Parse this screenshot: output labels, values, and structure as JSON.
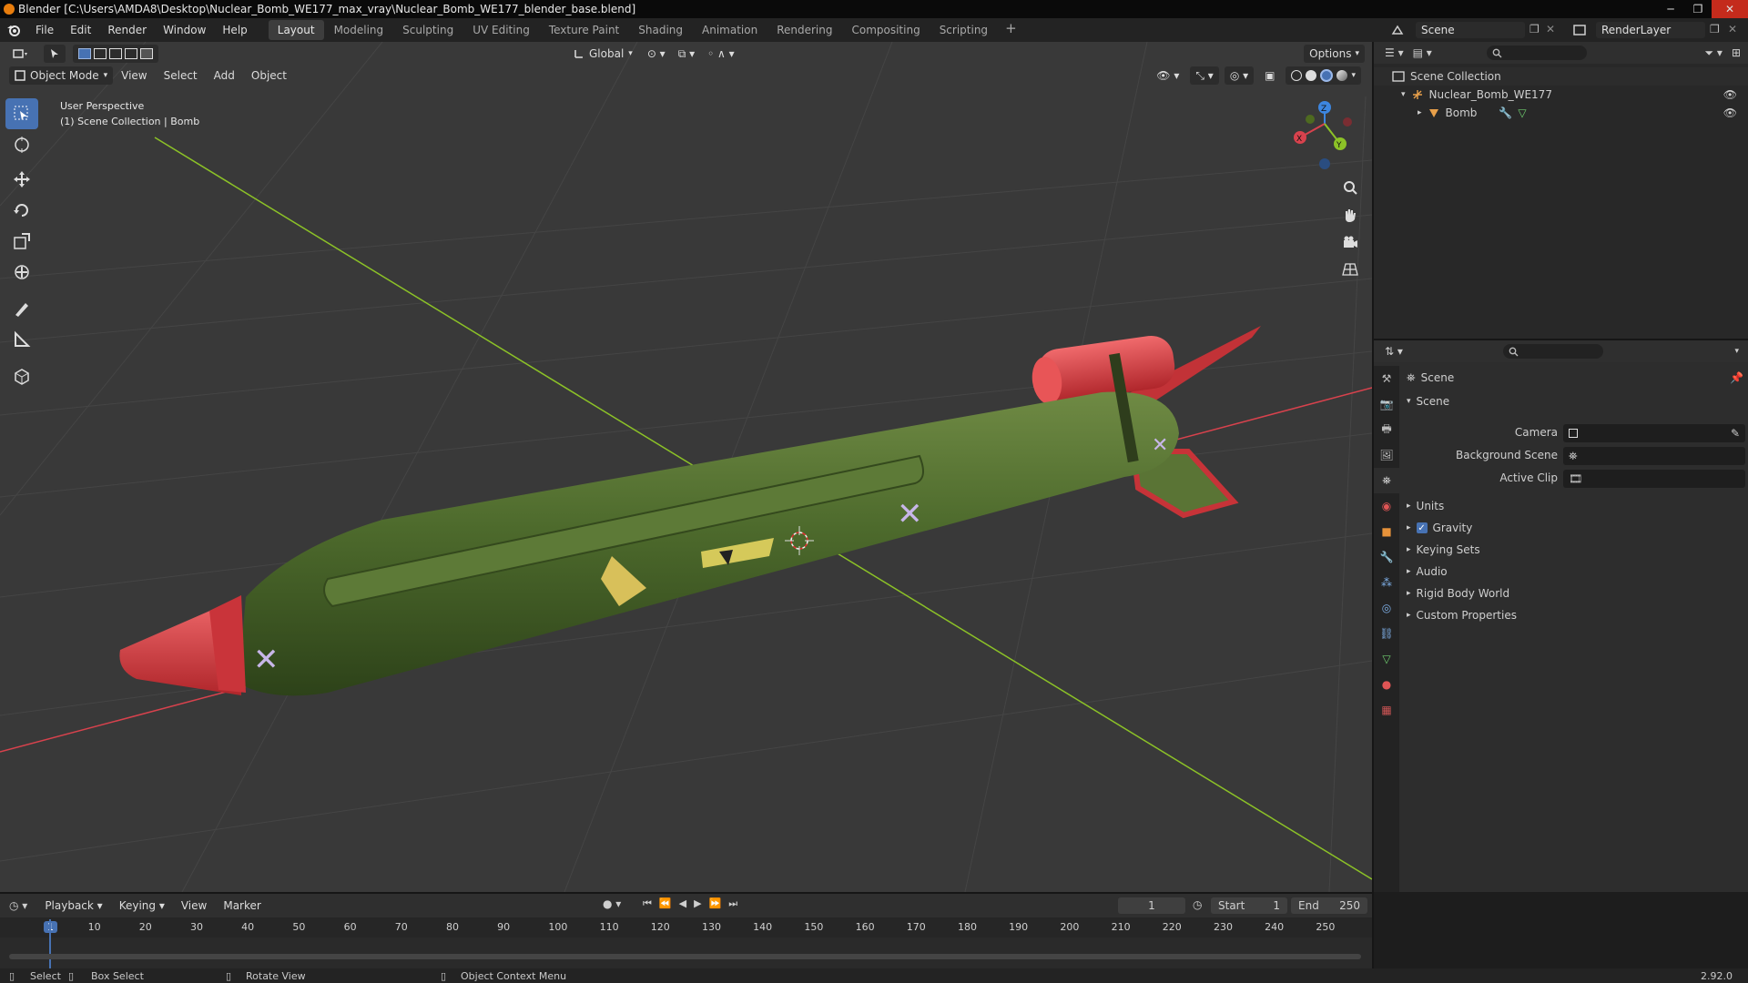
{
  "window": {
    "title": "Blender [C:\\Users\\AMDA8\\Desktop\\Nuclear_Bomb_WE177_max_vray\\Nuclear_Bomb_WE177_blender_base.blend]",
    "controls": [
      "─",
      "❐",
      "✕"
    ]
  },
  "menubar": {
    "menus": [
      "File",
      "Edit",
      "Render",
      "Window",
      "Help"
    ],
    "workspaces": [
      "Layout",
      "Modeling",
      "Sculpting",
      "UV Editing",
      "Texture Paint",
      "Shading",
      "Animation",
      "Rendering",
      "Compositing",
      "Scripting"
    ],
    "add_tab": "+",
    "scene_name": "Scene",
    "view_layer": "RenderLayer"
  },
  "viewport": {
    "transform_orientation": "Global",
    "options_label": "Options",
    "mode": "Object Mode",
    "header_menus": [
      "View",
      "Select",
      "Add",
      "Object"
    ],
    "overlay_line1": "User Perspective",
    "overlay_line2": "(1) Scene Collection | Bomb",
    "gizmo_axes": {
      "x": "X",
      "y": "Y",
      "z": "Z"
    }
  },
  "outliner": {
    "root": "Scene Collection",
    "items": [
      {
        "label": "Nuclear_Bomb_WE177",
        "type": "empty"
      },
      {
        "label": "Bomb",
        "type": "mesh"
      }
    ]
  },
  "properties": {
    "header": "Scene",
    "panel_title": "Scene",
    "fields": [
      {
        "label": "Camera"
      },
      {
        "label": "Background Scene"
      },
      {
        "label": "Active Clip"
      }
    ],
    "subpanels": [
      "Units",
      "Gravity",
      "Keying Sets",
      "Audio",
      "Rigid Body World",
      "Custom Properties"
    ],
    "gravity_checked": true
  },
  "timeline": {
    "menus": [
      "Playback",
      "Keying",
      "View",
      "Marker"
    ],
    "current_frame": "1",
    "start_label": "Start",
    "start_value": "1",
    "end_label": "End",
    "end_value": "250",
    "ticks": [
      "1",
      "10",
      "20",
      "30",
      "40",
      "50",
      "60",
      "70",
      "80",
      "90",
      "100",
      "110",
      "120",
      "130",
      "140",
      "150",
      "160",
      "170",
      "180",
      "190",
      "200",
      "210",
      "220",
      "230",
      "240",
      "250"
    ]
  },
  "statusbar": {
    "select": "Select",
    "box_select": "Box Select",
    "rotate_view": "Rotate View",
    "context_menu": "Object Context Menu",
    "version": "2.92.0"
  },
  "colors": {
    "accent": "#4772b3",
    "x_axis": "#d8424d",
    "y_axis": "#8cc227",
    "z_axis": "#3d86e0",
    "bomb_body": "#4d6a2c",
    "bomb_red": "#d8383c"
  }
}
